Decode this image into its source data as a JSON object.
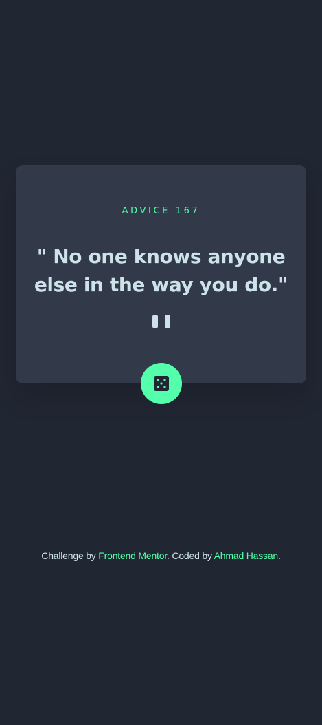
{
  "card": {
    "advice_label": "ADVICE 167",
    "quote": "\" No one knows anyone else in the way you do.\""
  },
  "divider": {
    "icon": "pause-icon"
  },
  "dice_button": {
    "icon": "dice-icon"
  },
  "footer": {
    "prefix": "Challenge by ",
    "link1": "Frontend Mentor",
    "middle": ". Coded by ",
    "link2": "Ahmad Hassan",
    "suffix": "."
  },
  "colors": {
    "background": "#202632",
    "card": "#323a49",
    "accent": "#53ffaa",
    "text": "#cee3e9",
    "divider": "#4f5d74"
  }
}
